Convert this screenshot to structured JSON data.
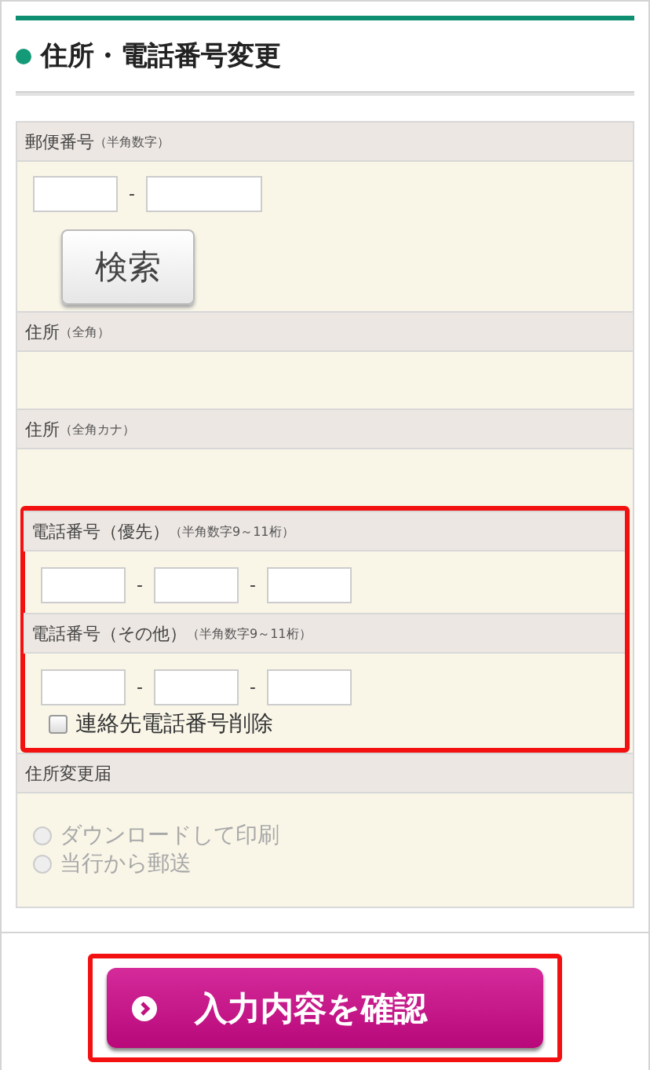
{
  "title": "住所・電話番号変更",
  "sections": [
    {
      "kind": "postal",
      "label": "郵便番号",
      "note": "（半角数字）",
      "highlighted": false,
      "separators": [
        "-"
      ],
      "button": "検索"
    },
    {
      "kind": "blank",
      "label": "住所",
      "note": "（全角）",
      "highlighted": false
    },
    {
      "kind": "blank",
      "label": "住所",
      "note": "（全角カナ）",
      "highlighted": false
    },
    {
      "kind": "phone",
      "label": "電話番号（優先）",
      "note": "（半角数字9～11桁）",
      "highlighted": true,
      "separators": [
        "-",
        "-"
      ]
    },
    {
      "kind": "phone",
      "label": "電話番号（その他）",
      "note": "（半角数字9～11桁）",
      "highlighted": true,
      "separators": [
        "-",
        "-"
      ],
      "checkbox": {
        "label": "連絡先電話番号削除",
        "checked": false
      }
    },
    {
      "kind": "radios",
      "label": "住所変更届",
      "highlighted": false,
      "options": [
        {
          "label": "ダウンロードして印刷",
          "selected": false,
          "disabled": true
        },
        {
          "label": "当行から郵送",
          "selected": false,
          "disabled": true
        }
      ]
    }
  ],
  "submit": {
    "label": "入力内容を確認",
    "highlighted": true
  }
}
